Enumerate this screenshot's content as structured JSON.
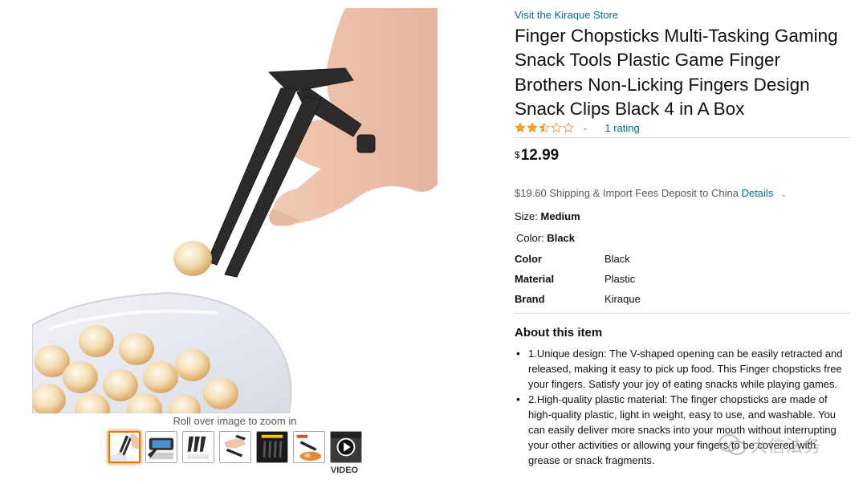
{
  "gallery": {
    "zoom_hint": "Roll over image to zoom in",
    "thumbnails": [
      {
        "icon": "product-chopsticks-thumb",
        "selected": true
      },
      {
        "icon": "gameplay-thumb",
        "selected": false
      },
      {
        "icon": "package-thumb",
        "selected": false
      },
      {
        "icon": "hand-use-thumb",
        "selected": false
      },
      {
        "icon": "dimensions-thumb",
        "selected": false
      },
      {
        "icon": "snack-use-thumb",
        "selected": false
      },
      {
        "icon": "video-play-thumb",
        "selected": false
      }
    ],
    "video_label": "VIDEO"
  },
  "product": {
    "store_link": "Visit the Kiraque Store",
    "title": "Finger Chopsticks Multi-Tasking Gaming Snack Tools Plastic Game Finger Brothers Non-Licking Fingers Design Snack Clips Black 4 in A Box",
    "rating_value": 2.5,
    "rating_count": "1 rating",
    "price_symbol": "$",
    "price_amount": "12.99",
    "shipping_text": "$19.60 Shipping & Import Fees Deposit to China",
    "shipping_details": "Details",
    "size_label": "Size:",
    "size_value": "Medium",
    "color_label": "Color:",
    "color_value": "Black",
    "specs": [
      {
        "key": "Color",
        "value": "Black"
      },
      {
        "key": "Material",
        "value": "Plastic"
      },
      {
        "key": "Brand",
        "value": "Kiraque"
      }
    ],
    "about_title": "About this item",
    "bullets": [
      "1.Unique design: The V-shaped opening can be easily retracted and released, making it easy to pick up food. This Finger chopsticks free your fingers. Satisfy your joy of eating snacks while playing games.",
      "2.High-quality plastic material: The finger chopsticks are made of high-quality plastic, light in weight, easy to use, and washable. You can easily deliver more snacks into your mouth without interrupting your other activities or allowing your fingers to be covered with grease or snack fragments."
    ]
  },
  "watermark": {
    "text": "大信法务"
  },
  "colors": {
    "link": "#007185",
    "star": "#ffa41c",
    "selected_border": "#e77600"
  }
}
